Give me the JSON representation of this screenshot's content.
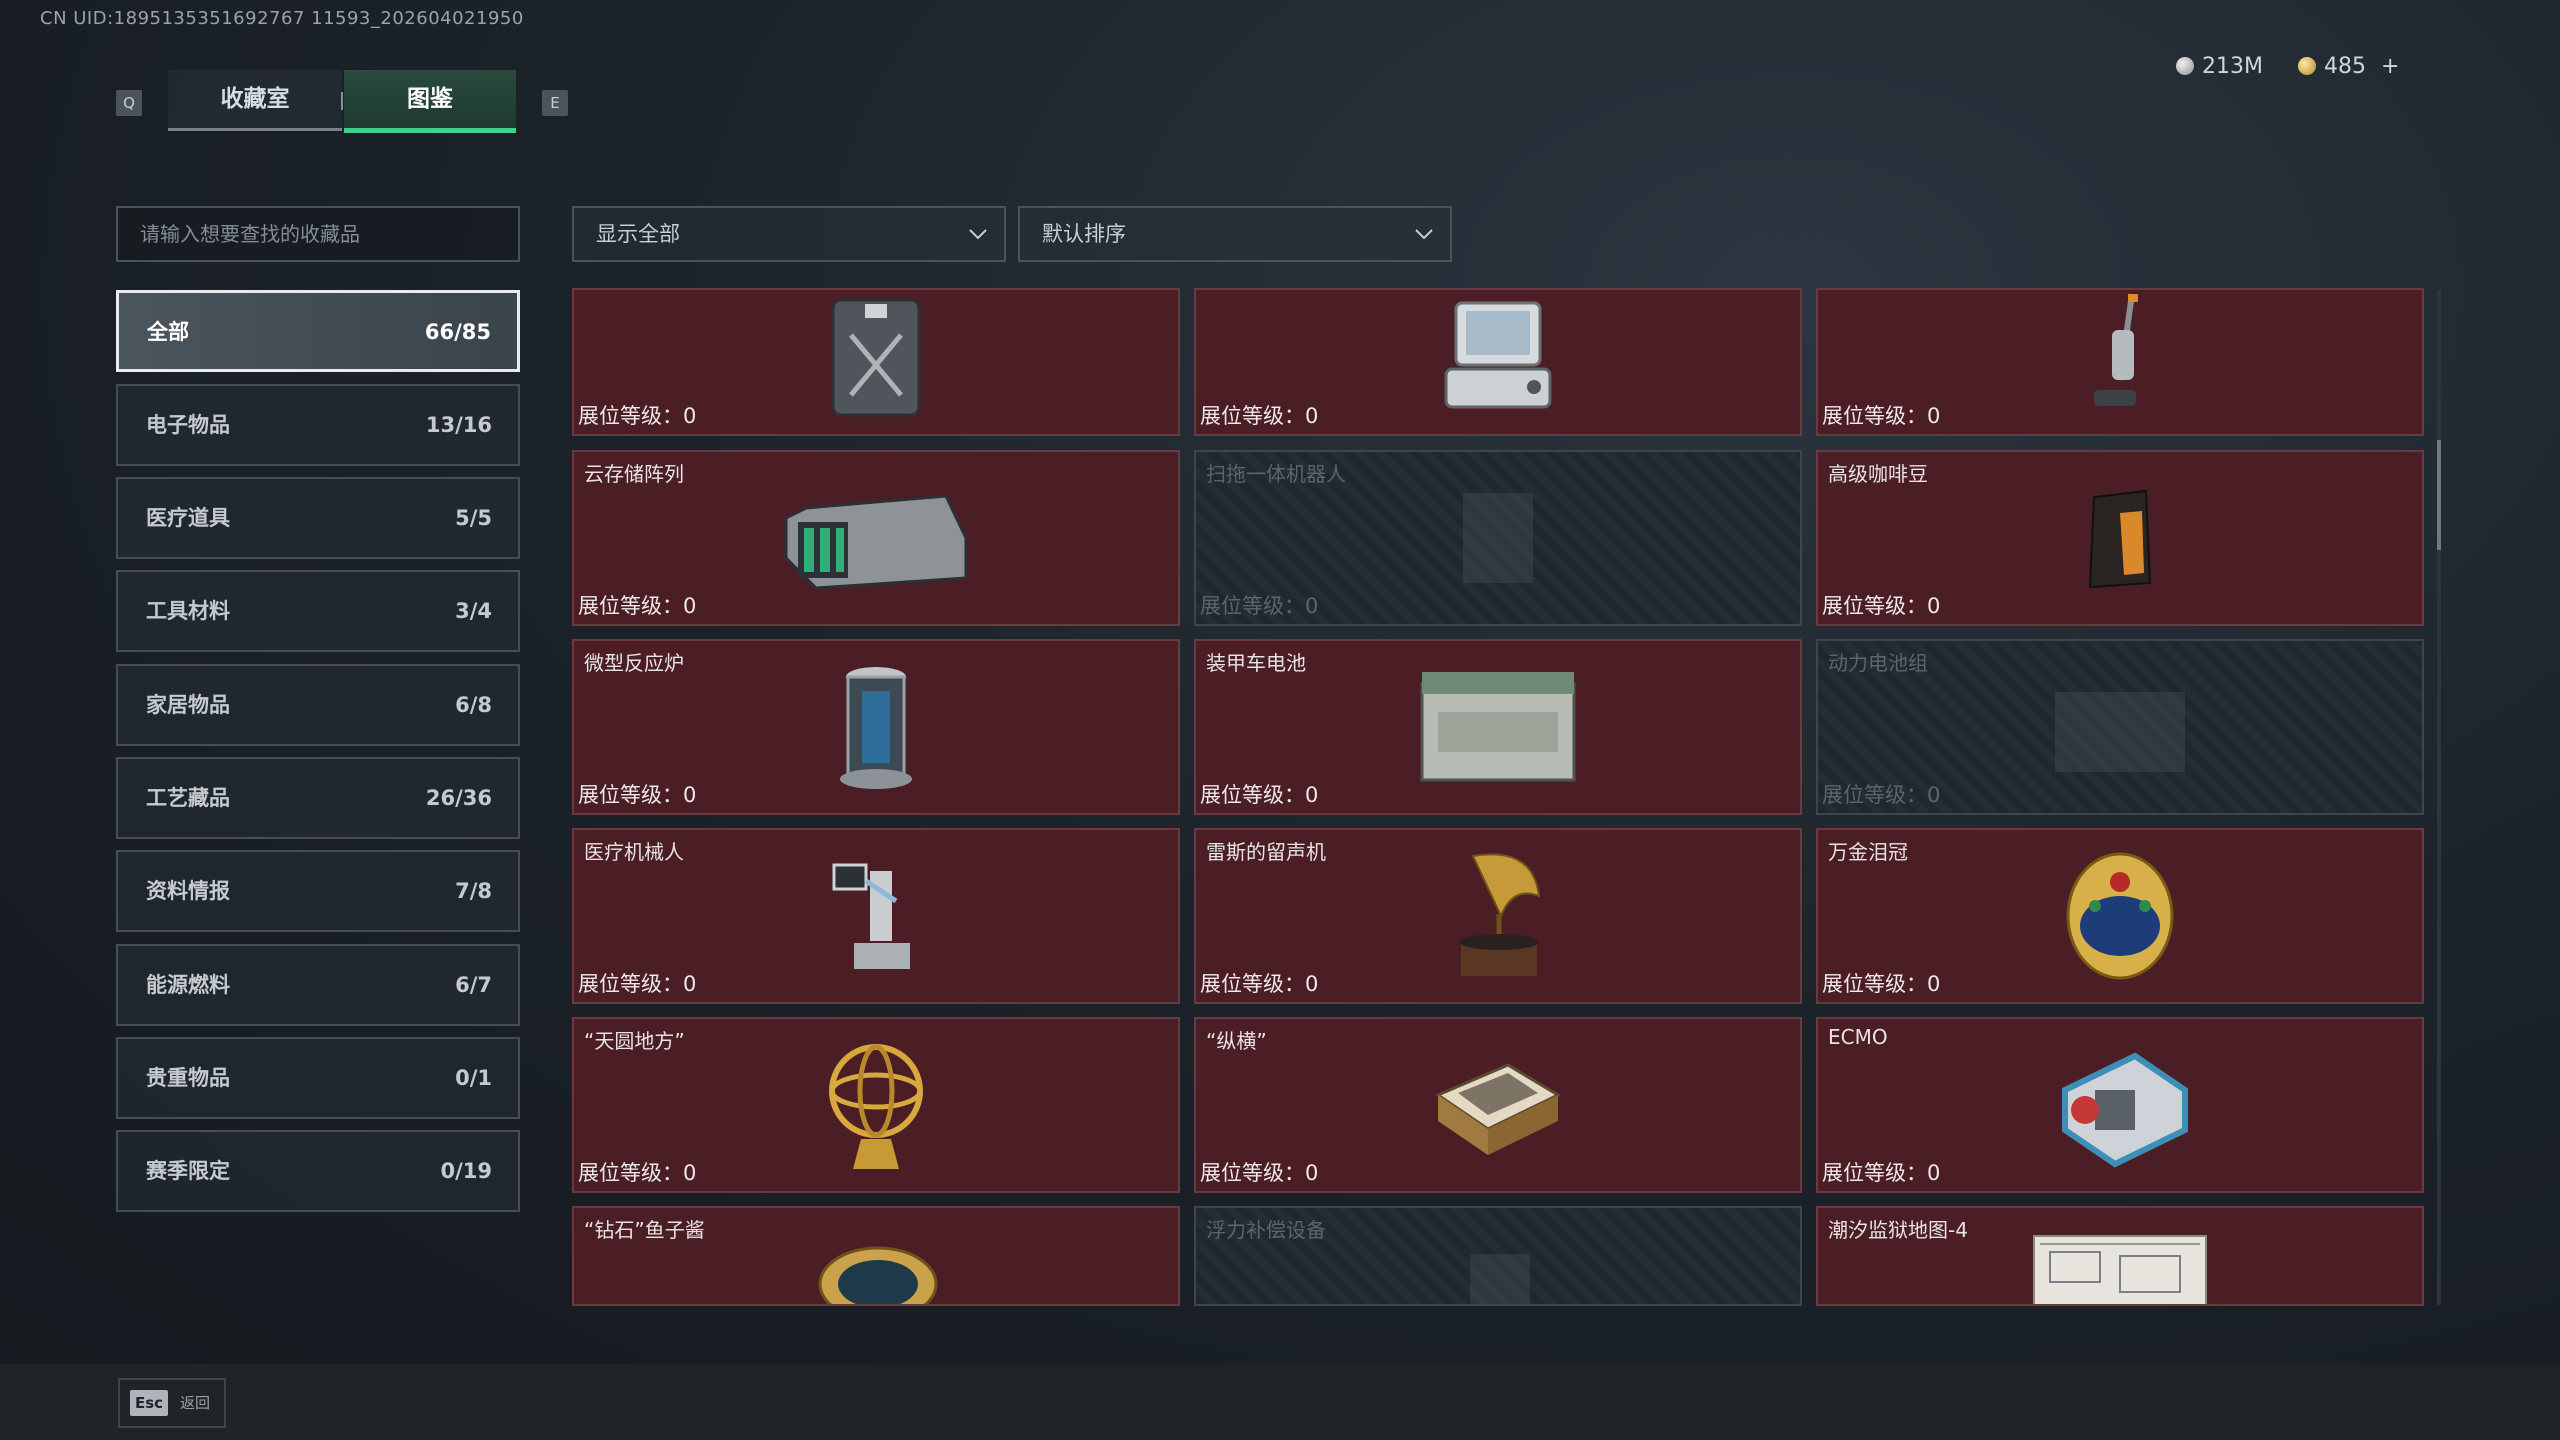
{
  "uid_text": "CN UID:1895135351692767 11593_202604021950",
  "nav": {
    "left_key": "Q",
    "right_key": "E",
    "tabs": [
      {
        "label": "收藏室",
        "active": false
      },
      {
        "label": "图鉴",
        "active": true
      }
    ]
  },
  "currency": {
    "silver": "213M",
    "gold": "485",
    "add": "+"
  },
  "search": {
    "placeholder": "请输入想要查找的收藏品"
  },
  "filters": {
    "display": "显示全部",
    "sort": "默认排序"
  },
  "categories": [
    {
      "label": "全部",
      "count": "66/85",
      "selected": true
    },
    {
      "label": "电子物品",
      "count": "13/16"
    },
    {
      "label": "医疗道具",
      "count": "5/5"
    },
    {
      "label": "工具材料",
      "count": "3/4"
    },
    {
      "label": "家居物品",
      "count": "6/8"
    },
    {
      "label": "工艺藏品",
      "count": "26/36"
    },
    {
      "label": "资料情报",
      "count": "7/8"
    },
    {
      "label": "能源燃料",
      "count": "6/7"
    },
    {
      "label": "贵重物品",
      "count": "0/1"
    },
    {
      "label": "赛季限定",
      "count": "0/19"
    }
  ],
  "level_label": "展位等级：",
  "items": [
    {
      "name": "",
      "level": "0",
      "locked": false,
      "icon": "jerrycan-icon"
    },
    {
      "name": "",
      "level": "0",
      "locked": false,
      "icon": "computer-terminal-icon"
    },
    {
      "name": "",
      "level": "0",
      "locked": false,
      "icon": "vacuum-cleaner-icon"
    },
    {
      "name": "云存储阵列",
      "level": "0",
      "locked": false,
      "icon": "storage-array-icon"
    },
    {
      "name": "扫拖一体机器人",
      "level": "0",
      "locked": true,
      "icon": "mop-robot-icon"
    },
    {
      "name": "高级咖啡豆",
      "level": "0",
      "locked": false,
      "icon": "coffee-bag-icon"
    },
    {
      "name": "微型反应炉",
      "level": "0",
      "locked": false,
      "icon": "reactor-icon"
    },
    {
      "name": "装甲车电池",
      "level": "0",
      "locked": false,
      "icon": "car-battery-icon"
    },
    {
      "name": "动力电池组",
      "level": "0",
      "locked": true,
      "icon": "battery-pack-icon"
    },
    {
      "name": "医疗机械人",
      "level": "0",
      "locked": false,
      "icon": "medical-robot-icon"
    },
    {
      "name": "雷斯的留声机",
      "level": "0",
      "locked": false,
      "icon": "gramophone-icon"
    },
    {
      "name": "万金泪冠",
      "level": "0",
      "locked": false,
      "icon": "jeweled-egg-icon"
    },
    {
      "name": "“天圆地方”",
      "level": "0",
      "locked": false,
      "icon": "armillary-sphere-icon"
    },
    {
      "name": "“纵横”",
      "level": "0",
      "locked": false,
      "icon": "chess-box-icon"
    },
    {
      "name": "ECMO",
      "level": "0",
      "locked": false,
      "icon": "ecmo-machine-icon"
    },
    {
      "name": "“钻石”鱼子酱",
      "level": "",
      "locked": false,
      "icon": "caviar-tin-icon"
    },
    {
      "name": "浮力补偿设备",
      "level": "",
      "locked": true,
      "icon": "buoyancy-device-icon"
    },
    {
      "name": "潮汐监狱地图-4",
      "level": "",
      "locked": false,
      "icon": "map-icon"
    }
  ],
  "footer": {
    "key": "Esc",
    "label": "返回"
  },
  "colors": {
    "accent": "#3fcf8e",
    "card_bg": "#4a1e24"
  }
}
